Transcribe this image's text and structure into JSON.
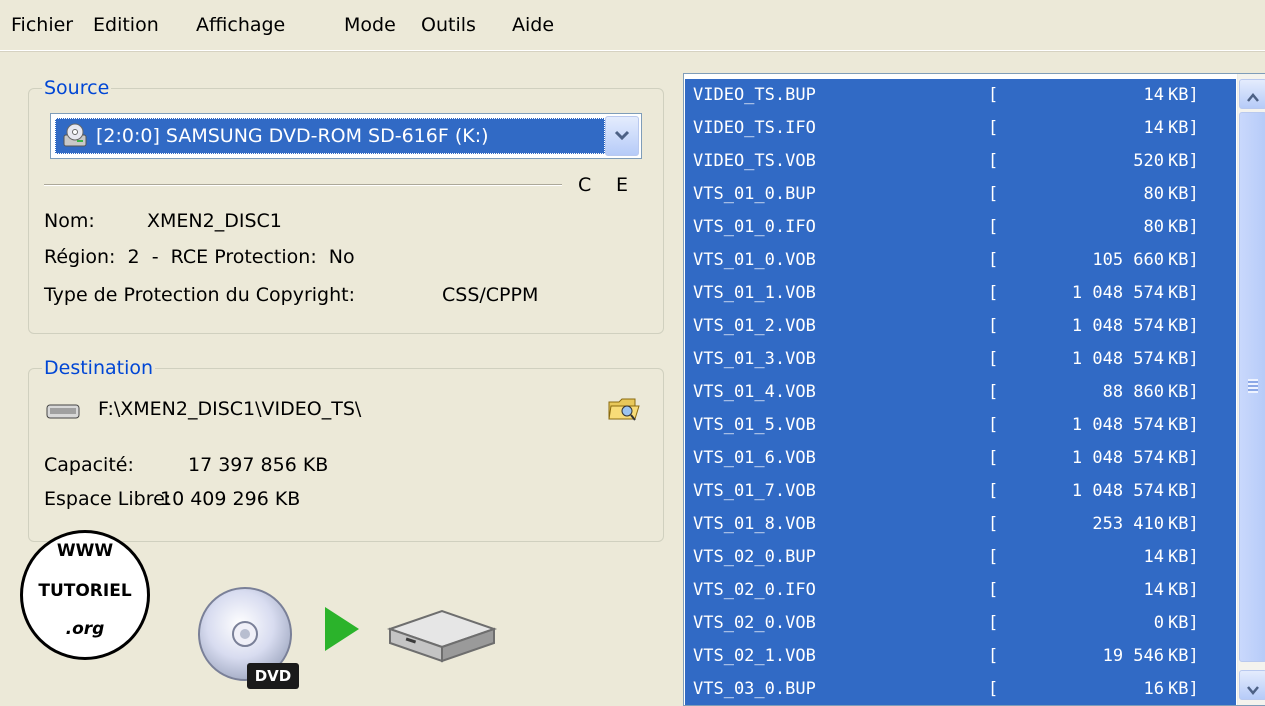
{
  "menu": [
    "Fichier",
    "Edition",
    "Affichage",
    "Mode",
    "Outils",
    "Aide"
  ],
  "source": {
    "title": "Source",
    "drive": "[2:0:0] SAMSUNG DVD-ROM SD-616F (K:)",
    "flags": {
      "c": "C",
      "e": "E"
    },
    "nom_label": "Nom:",
    "nom_value": "XMEN2_DISC1",
    "region_line": "Région:  2  -  RCE Protection:  No",
    "protection_label": "Type de Protection du Copyright:",
    "protection_value": "CSS/CPPM"
  },
  "destination": {
    "title": "Destination",
    "path": "F:\\XMEN2_DISC1\\VIDEO_TS\\",
    "capacity_label": "Capacité:",
    "capacity_value": "17 397 856 KB",
    "free_label": "Espace Libre:",
    "free_value": "10 409 296 KB"
  },
  "watermark": {
    "top": "WWW",
    "middle": "TUTORIEL",
    "bottom": ".org"
  },
  "dvd_badge": "DVD",
  "files": [
    {
      "name": "VIDEO_TS.BUP",
      "size": "14"
    },
    {
      "name": "VIDEO_TS.IFO",
      "size": "14"
    },
    {
      "name": "VIDEO_TS.VOB",
      "size": "520"
    },
    {
      "name": "VTS_01_0.BUP",
      "size": "80"
    },
    {
      "name": "VTS_01_0.IFO",
      "size": "80"
    },
    {
      "name": "VTS_01_0.VOB",
      "size": "105 660"
    },
    {
      "name": "VTS_01_1.VOB",
      "size": "1 048 574"
    },
    {
      "name": "VTS_01_2.VOB",
      "size": "1 048 574"
    },
    {
      "name": "VTS_01_3.VOB",
      "size": "1 048 574"
    },
    {
      "name": "VTS_01_4.VOB",
      "size": "88 860"
    },
    {
      "name": "VTS_01_5.VOB",
      "size": "1 048 574"
    },
    {
      "name": "VTS_01_6.VOB",
      "size": "1 048 574"
    },
    {
      "name": "VTS_01_7.VOB",
      "size": "1 048 574"
    },
    {
      "name": "VTS_01_8.VOB",
      "size": "253 410"
    },
    {
      "name": "VTS_02_0.BUP",
      "size": "14"
    },
    {
      "name": "VTS_02_0.IFO",
      "size": "14"
    },
    {
      "name": "VTS_02_0.VOB",
      "size": "0"
    },
    {
      "name": "VTS_02_1.VOB",
      "size": "19 546"
    },
    {
      "name": "VTS_03_0.BUP",
      "size": "16"
    }
  ],
  "unit": "KB]",
  "bracket": "[",
  "colors": {
    "selection": "#316AC5",
    "group_title": "#0046D5",
    "window": "#ECE9D8"
  },
  "icons": [
    "dvd-drive-icon",
    "chevron-down-icon",
    "hard-drive-icon",
    "folder-browse-icon",
    "dvd-disc-icon",
    "play-arrow-icon",
    "chevron-up-icon",
    "scroll-grip-icon"
  ]
}
